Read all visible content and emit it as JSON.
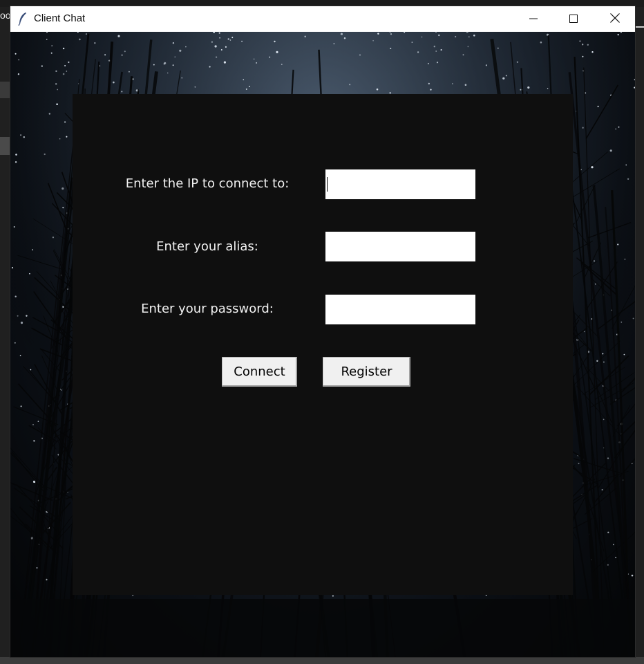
{
  "desktop": {
    "left_label": "oo"
  },
  "window": {
    "title": "Client Chat",
    "icon": "feather-icon",
    "controls": {
      "minimize_icon": "minimize-icon",
      "maximize_icon": "maximize-icon",
      "close_icon": "close-icon"
    }
  },
  "form": {
    "ip_label": "Enter the IP to connect to:",
    "ip_value": "",
    "alias_label": "Enter your alias:",
    "alias_value": "",
    "password_label": "Enter your password:",
    "password_value": "",
    "connect_label": "Connect",
    "register_label": "Register"
  },
  "colors": {
    "panel": "#0f0f0f",
    "label_text": "#f2f2f2",
    "field_bg": "#ffffff",
    "button_bg": "#f0f0f0",
    "titlebar": "#ffffff"
  }
}
